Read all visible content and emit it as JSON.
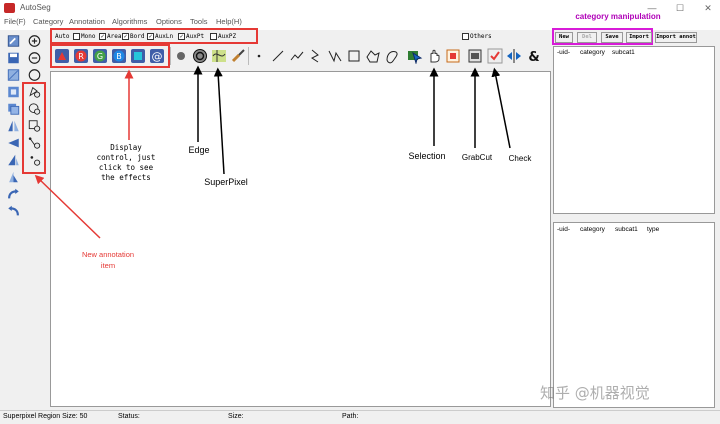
{
  "window": {
    "title": "AutoSeg",
    "controls": [
      "—",
      "☐",
      "✕"
    ]
  },
  "menu": [
    "File(F)",
    "Category",
    "Annotation",
    "Algorithms",
    "Options",
    "Tools",
    "Help(H)"
  ],
  "display_options": {
    "auto_label": "Auto",
    "checkboxes": [
      {
        "label": "Mono",
        "checked": false
      },
      {
        "label": "Area",
        "checked": true
      },
      {
        "label": "Bord",
        "checked": true
      },
      {
        "label": "AuxLn",
        "checked": true
      },
      {
        "label": "AuxPt",
        "checked": true
      },
      {
        "label": "AuxPZ",
        "checked": false
      }
    ],
    "others": {
      "label": "Others",
      "checked": false
    }
  },
  "tools_row": {
    "color_labels": [
      "R",
      "G",
      "B"
    ],
    "at_label": "@",
    "amp_label": "&"
  },
  "category_panel": {
    "heading": "category manipulation",
    "buttons": [
      {
        "label": "New",
        "enabled": true
      },
      {
        "label": "Del",
        "enabled": false
      },
      {
        "label": "Save",
        "enabled": true
      },
      {
        "label": "Import",
        "enabled": true
      },
      {
        "label": "Import annot",
        "enabled": true
      }
    ],
    "top_columns": [
      "-uid-",
      "category",
      "subcat1"
    ],
    "bottom_columns": [
      "-uid-",
      "category",
      "subcat1",
      "type"
    ]
  },
  "annotations": {
    "display_control": "Display\ncontrol, just\nclick to see\nthe effects",
    "edge": "Edge",
    "superpixel": "SuperPixel",
    "selection": "Selection",
    "grabcut": "GrabCut",
    "check": "Check",
    "new_annotation": "New annotation\nitem"
  },
  "watermark": "知乎 @机器视觉",
  "status": {
    "superpixel": "Superpixel Region Size: 50",
    "status_label": "Status:",
    "size_label": "Size:",
    "path_label": "Path:"
  },
  "colors": {
    "annotation_red": "#e53935",
    "highlight_magenta": "#d81bd8",
    "heading_purple": "#b000b8"
  }
}
